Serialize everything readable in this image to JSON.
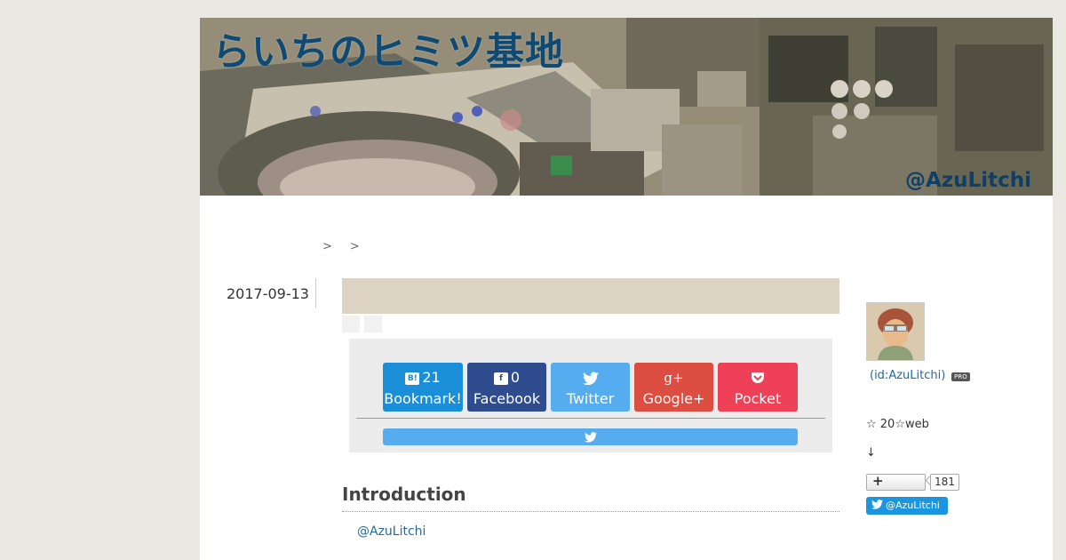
{
  "header": {
    "title": "らいちのヒミツ基地",
    "handle": "@AzuLitchi"
  },
  "breadcrumb": {
    "separators": [
      ">",
      ">"
    ]
  },
  "entry": {
    "date": "2017-09-13"
  },
  "share": {
    "buttons": [
      {
        "name": "hatena-bookmark-button",
        "icon": "hatena-b-icon",
        "icon_text": "B!",
        "count": "21",
        "label": "Bookmark!",
        "color": "#1a8fd8"
      },
      {
        "name": "facebook-button",
        "icon": "facebook-icon",
        "icon_text": "f",
        "count": "0",
        "label": "Facebook",
        "color": "#2f4d8e"
      },
      {
        "name": "twitter-button",
        "icon": "twitter-bird-icon",
        "icon_text": "",
        "count": "",
        "label": "Twitter",
        "color": "#55acee"
      },
      {
        "name": "google-plus-button",
        "icon": "google-plus-icon",
        "icon_text": "g+",
        "count": "",
        "label": "Google+",
        "color": "#dc4e41"
      },
      {
        "name": "pocket-button",
        "icon": "pocket-icon",
        "icon_text": "",
        "count": "",
        "label": "Pocket",
        "color": "#ee4056"
      }
    ],
    "tweet_bar_icon": "twitter-bird-icon"
  },
  "article": {
    "intro_heading": "Introduction",
    "intro_link": "@AzuLitchi"
  },
  "sidebar": {
    "user_id": "(id:AzuLitchi)",
    "pro_badge": "PRO",
    "stars_text": "☆ 20☆web",
    "arrow": "↓",
    "follow_icon": "+",
    "follow_count": "181",
    "twitter_follow": "@AzuLitchi"
  },
  "colors": {
    "background": "#eae8e3",
    "title_band": "#ddd3c3",
    "link": "#1e6aa0",
    "title_text": "#0e4a73"
  }
}
